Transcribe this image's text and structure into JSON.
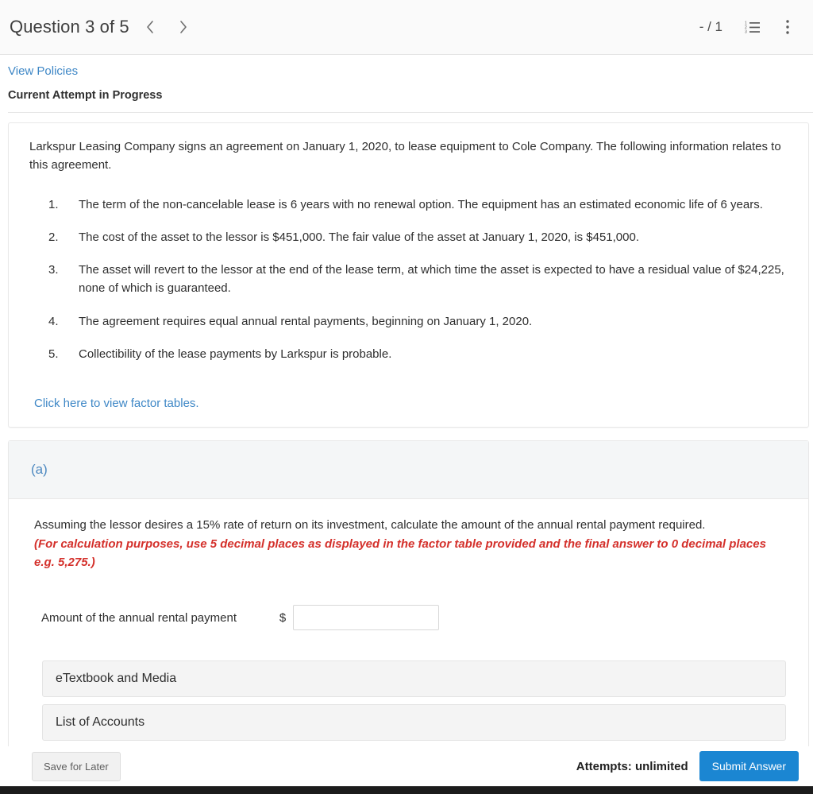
{
  "header": {
    "question_title": "Question 3 of 5",
    "prev_icon": "chevron-left-icon",
    "next_icon": "chevron-right-icon",
    "score": "- / 1",
    "list_icon": "numbered-list-icon",
    "menu_icon": "vertical-ellipsis-icon"
  },
  "subheader": {
    "policies_link": "View Policies",
    "attempt_status": "Current Attempt in Progress"
  },
  "problem": {
    "intro": "Larkspur Leasing Company signs an agreement on January 1, 2020, to lease equipment to Cole Company. The following information relates to this agreement.",
    "facts": [
      "The term of the non-cancelable lease is 6 years with no renewal option. The equipment has an estimated economic life of 6 years.",
      "The cost of the asset to the lessor is $451,000. The fair value of the asset at January 1, 2020, is $451,000.",
      "The asset will revert to the lessor at the end of the lease term, at which time the asset is expected to have a residual value of $24,225, none of which is guaranteed.",
      "The agreement requires equal annual rental payments, beginning on January 1, 2020.",
      "Collectibility of the lease payments by Larkspur is probable."
    ],
    "factor_tables_link": "Click here to view factor tables."
  },
  "part_a": {
    "label": "(a)",
    "prompt": "Assuming the lessor desires a 15% rate of return on its investment, calculate the amount of the annual rental payment required.",
    "prompt_note": "(For calculation purposes, use 5 decimal places as displayed in the factor table provided and the final answer to 0 decimal places e.g. 5,275.)",
    "answer_label": "Amount of the annual rental payment",
    "currency_symbol": "$",
    "answer_value": "",
    "answer_placeholder": ""
  },
  "resources": {
    "etextbook": "eTextbook and Media",
    "list_of_accounts": "List of Accounts"
  },
  "footer": {
    "save_label": "Save for Later",
    "attempts": "Attempts: unlimited",
    "submit_label": "Submit Answer"
  },
  "colors": {
    "link_blue": "#3e87c6",
    "accent_blue": "#1b86d2",
    "note_red": "#d4302b",
    "header_bg": "#fafafa",
    "panel_bg": "#f4f4f4"
  }
}
